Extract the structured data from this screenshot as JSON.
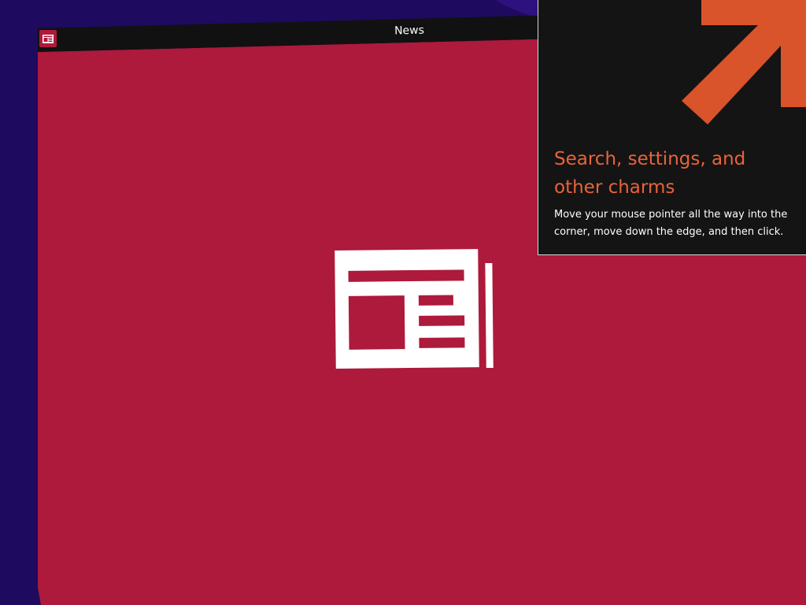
{
  "window": {
    "title": "News",
    "icon": "news-app-icon"
  },
  "splash": {
    "icon": "newspaper-icon"
  },
  "charms_hint": {
    "title": "Search, settings, and other charms",
    "body": "Move your mouse pointer all the way into the corner, move down the edge, and then click.",
    "icon": "arrow-up-right-icon"
  },
  "colors": {
    "desktop_background": "#1e0a5e",
    "app_background": "#ad1a3b",
    "titlebar": "#111111",
    "hint_background": "#141414",
    "hint_accent": "#e8643a",
    "arrow": "#d9532b"
  }
}
